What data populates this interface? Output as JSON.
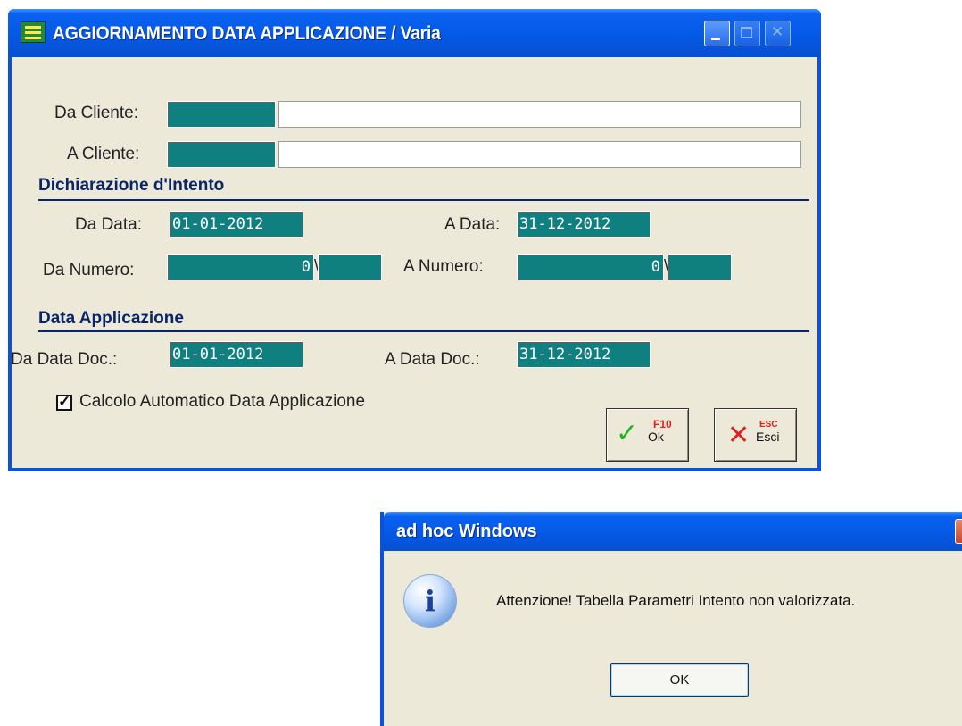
{
  "main_window": {
    "title": "AGGIORNAMENTO DATA APPLICAZIONE / Varia",
    "da_cliente_label": "Da Cliente:",
    "a_cliente_label": "A Cliente:",
    "da_cliente_code": "",
    "da_cliente_name": "",
    "a_cliente_code": "",
    "a_cliente_name": "",
    "section_intento": "Dichiarazione d'Intento",
    "da_data_label": "Da Data:",
    "da_data_value": "01-01-2012",
    "a_data_label": "A Data:",
    "a_data_value": "31-12-2012",
    "da_numero_label": "Da Numero:",
    "da_numero_value": "0",
    "da_numero_serie": "",
    "a_numero_label": "A Numero:",
    "a_numero_value": "0",
    "a_numero_serie": "",
    "separator": "\\",
    "section_applicazione": "Data Applicazione",
    "da_data_doc_label": "Da Data Doc.:",
    "da_data_doc_value": "01-01-2012",
    "a_data_doc_label": "A Data Doc.:",
    "a_data_doc_value": "31-12-2012",
    "checkbox_label": "Calcolo Automatico Data Applicazione",
    "checkbox_checked": true,
    "ok_key": "F10",
    "ok_label": "Ok",
    "esc_key": "ESC",
    "esc_label": "Esci"
  },
  "dialog": {
    "title": "ad hoc Windows",
    "message": "Attenzione! Tabella Parametri Intento non valorizzata.",
    "ok_label": "OK",
    "icon": "info-icon"
  },
  "colors": {
    "titlebar": "#0A53D8",
    "client_bg": "#ECE9D8",
    "field_teal": "#0F7F80",
    "section_text": "#0A246A"
  }
}
